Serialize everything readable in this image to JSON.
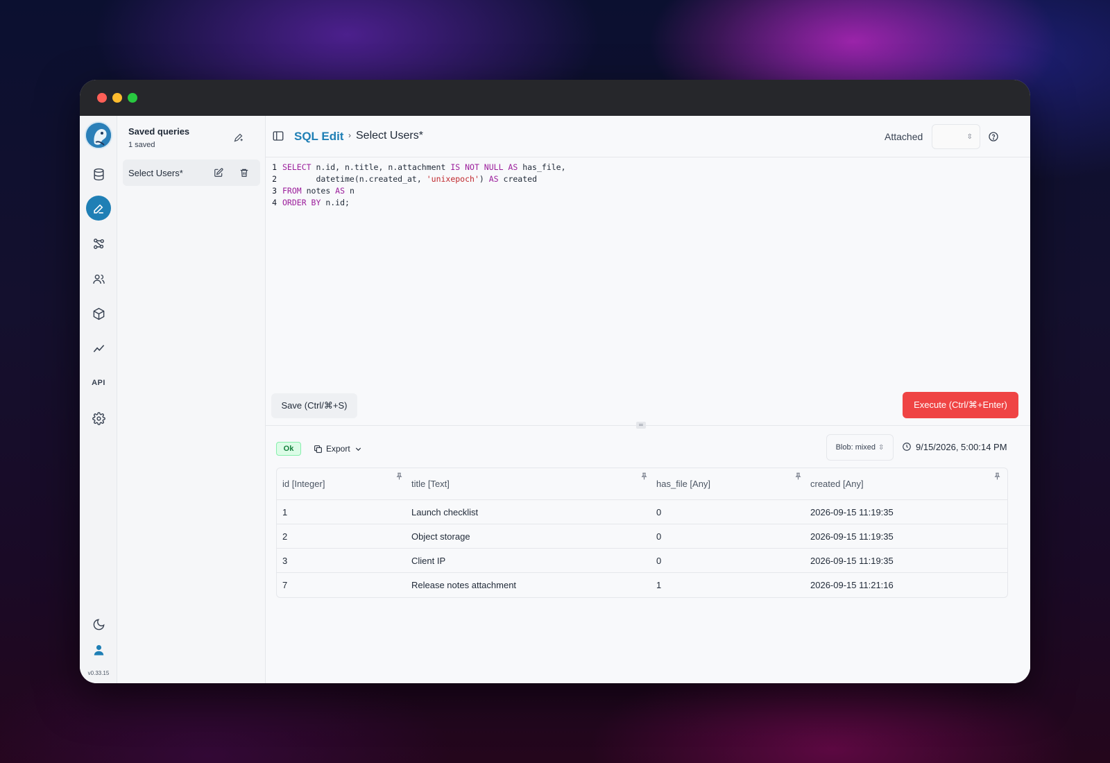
{
  "app": {
    "version": "v0.33.15"
  },
  "rail": {
    "items": [
      {
        "name": "database-icon"
      },
      {
        "name": "edit-icon",
        "active": true
      },
      {
        "name": "graph-icon"
      },
      {
        "name": "users-icon"
      },
      {
        "name": "box-icon"
      },
      {
        "name": "chart-line-icon"
      },
      {
        "name": "api",
        "label": "API"
      },
      {
        "name": "gear-icon"
      }
    ]
  },
  "sidebar": {
    "title": "Saved queries",
    "subtitle": "1 saved",
    "items": [
      {
        "label": "Select Users*"
      }
    ]
  },
  "header": {
    "section": "SQL Edit",
    "separator": "›",
    "page": "Select Users*",
    "attached_label": "Attached"
  },
  "editor": {
    "lines": [
      {
        "num": "1"
      },
      {
        "num": "2"
      },
      {
        "num": "3"
      },
      {
        "num": "4"
      }
    ]
  },
  "actions": {
    "save_label": "Save (Ctrl/⌘+S)",
    "execute_label": "Execute (Ctrl/⌘+Enter)"
  },
  "results": {
    "status": "Ok",
    "export_label": "Export",
    "blob_mode": "Blob: mixed",
    "timestamp": "9/15/2026, 5:00:14 PM",
    "columns": [
      "id [Integer]",
      "title [Text]",
      "has_file [Any]",
      "created [Any]"
    ],
    "rows": [
      [
        "1",
        "Launch checklist",
        "0",
        "2026-09-15 11:19:35"
      ],
      [
        "2",
        "Object storage",
        "0",
        "2026-09-15 11:19:35"
      ],
      [
        "3",
        "Client IP",
        "0",
        "2026-09-15 11:19:35"
      ],
      [
        "7",
        "Release notes attachment",
        "1",
        "2026-09-15 11:21:16"
      ]
    ]
  },
  "colors": {
    "accent": "#1f7fb5",
    "execute": "#ef4444",
    "keyword": "#9b1d9b",
    "string": "#c0282d",
    "ok": "#15803d"
  }
}
